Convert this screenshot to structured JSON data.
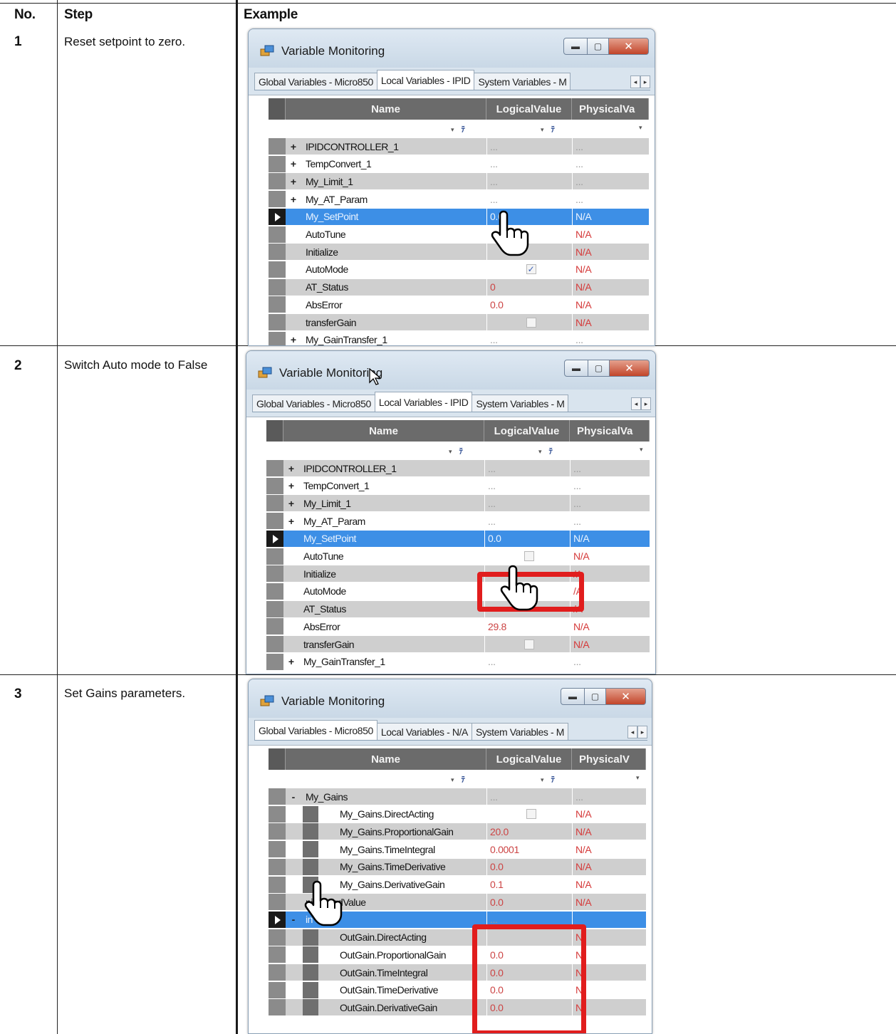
{
  "table": {
    "headers": {
      "no": "No.",
      "step": "Step",
      "example": "Example"
    }
  },
  "steps": [
    {
      "no": "1",
      "text": "Reset setpoint to zero.",
      "window": {
        "title": "Variable Monitoring",
        "tabs": [
          "Global Variables - Micro850",
          "Local Variables - IPID",
          "System Variables - M"
        ],
        "active_tab": 1,
        "columns": [
          "Name",
          "LogicalValue",
          "PhysicalVa"
        ],
        "rows": [
          {
            "expand": "+",
            "name": "IPIDCONTROLLER_1",
            "lv": "...",
            "pv": "..."
          },
          {
            "expand": "+",
            "name": "TempConvert_1",
            "lv": "...",
            "pv": "..."
          },
          {
            "expand": "+",
            "name": "My_Limit_1",
            "lv": "...",
            "pv": "..."
          },
          {
            "expand": "+",
            "name": "My_AT_Param",
            "lv": "...",
            "pv": "..."
          },
          {
            "expand": "",
            "name": "My_SetPoint",
            "lv": "0.0",
            "pv": "N/A",
            "selected": true
          },
          {
            "expand": "",
            "name": "AutoTune",
            "lv": "",
            "pv": "N/A"
          },
          {
            "expand": "",
            "name": "Initialize",
            "lv": "",
            "pv": "N/A"
          },
          {
            "expand": "",
            "name": "AutoMode",
            "lv": "✓",
            "pv": "N/A",
            "checkbox": true
          },
          {
            "expand": "",
            "name": "AT_Status",
            "lv": "0",
            "pv": "N/A"
          },
          {
            "expand": "",
            "name": "AbsError",
            "lv": "0.0",
            "pv": "N/A"
          },
          {
            "expand": "",
            "name": "transferGain",
            "lv": "",
            "pv": "N/A",
            "checkbox": true
          },
          {
            "expand": "+",
            "name": "My_GainTransfer_1",
            "lv": "...",
            "pv": "..."
          }
        ]
      }
    },
    {
      "no": "2",
      "text": "Switch Auto mode to False",
      "window": {
        "title": "Variable Monitoring",
        "tabs": [
          "Global Variables - Micro850",
          "Local Variables - IPID",
          "System Variables - M"
        ],
        "active_tab": 1,
        "columns": [
          "Name",
          "LogicalValue",
          "PhysicalVa"
        ],
        "rows": [
          {
            "expand": "+",
            "name": "IPIDCONTROLLER_1",
            "lv": "...",
            "pv": "..."
          },
          {
            "expand": "+",
            "name": "TempConvert_1",
            "lv": "...",
            "pv": "..."
          },
          {
            "expand": "+",
            "name": "My_Limit_1",
            "lv": "...",
            "pv": "..."
          },
          {
            "expand": "+",
            "name": "My_AT_Param",
            "lv": "...",
            "pv": "..."
          },
          {
            "expand": "",
            "name": "My_SetPoint",
            "lv": "0.0",
            "pv": "N/A",
            "selected": true
          },
          {
            "expand": "",
            "name": "AutoTune",
            "lv": "",
            "pv": "N/A",
            "checkbox": true
          },
          {
            "expand": "",
            "name": "Initialize",
            "lv": "",
            "pv": "/A"
          },
          {
            "expand": "",
            "name": "AutoMode",
            "lv": "",
            "pv": "/A"
          },
          {
            "expand": "",
            "name": "AT_Status",
            "lv": "",
            "pv": "/A"
          },
          {
            "expand": "",
            "name": "AbsError",
            "lv": "29.8",
            "pv": "N/A"
          },
          {
            "expand": "",
            "name": "transferGain",
            "lv": "",
            "pv": "N/A",
            "checkbox": true
          },
          {
            "expand": "+",
            "name": "My_GainTransfer_1",
            "lv": "...",
            "pv": "..."
          }
        ]
      }
    },
    {
      "no": "3",
      "text": "Set Gains parameters.",
      "window": {
        "title": "Variable Monitoring",
        "tabs": [
          "Global Variables - Micro850",
          "Local Variables - N/A",
          "System Variables - M"
        ],
        "active_tab": 0,
        "columns": [
          "Name",
          "LogicalValue",
          "PhysicalV"
        ],
        "rows": [
          {
            "expand": "-",
            "name": "My_Gains",
            "lv": "...",
            "pv": "...",
            "level": 0
          },
          {
            "expand": "",
            "name": "My_Gains.DirectActing",
            "lv": "",
            "pv": "N/A",
            "level": 1,
            "checkbox": true
          },
          {
            "expand": "",
            "name": "My_Gains.ProportionalGain",
            "lv": "20.0",
            "pv": "N/A",
            "level": 1
          },
          {
            "expand": "",
            "name": "My_Gains.TimeIntegral",
            "lv": "0.0001",
            "pv": "N/A",
            "level": 1
          },
          {
            "expand": "",
            "name": "My_Gains.TimeDerivative",
            "lv": "0.0",
            "pv": "N/A",
            "level": 1
          },
          {
            "expand": "",
            "name": "My_Gains.DerivativeGain",
            "lv": "0.1",
            "pv": "N/A",
            "level": 1
          },
          {
            "expand": "",
            "name": "nipulatedValue",
            "lv": "0.0",
            "pv": "N/A",
            "level": 0
          },
          {
            "expand": "-",
            "name": "in",
            "lv": "...",
            "pv": "",
            "level": 0,
            "selected": true
          },
          {
            "expand": "",
            "name": "OutGain.DirectActing",
            "lv": "",
            "pv": "N",
            "level": 1
          },
          {
            "expand": "",
            "name": "OutGain.ProportionalGain",
            "lv": "0.0",
            "pv": "N",
            "level": 1
          },
          {
            "expand": "",
            "name": "OutGain.TimeIntegral",
            "lv": "0.0",
            "pv": "N",
            "level": 1
          },
          {
            "expand": "",
            "name": "OutGain.TimeDerivative",
            "lv": "0.0",
            "pv": "N",
            "level": 1
          },
          {
            "expand": "",
            "name": "OutGain.DerivativeGain",
            "lv": "0.0",
            "pv": "N",
            "level": 1
          }
        ]
      }
    }
  ],
  "colors": {
    "selected_row": "#3d8fe6",
    "highlight": "#e11d1d",
    "value_red": "#d53a3a"
  }
}
